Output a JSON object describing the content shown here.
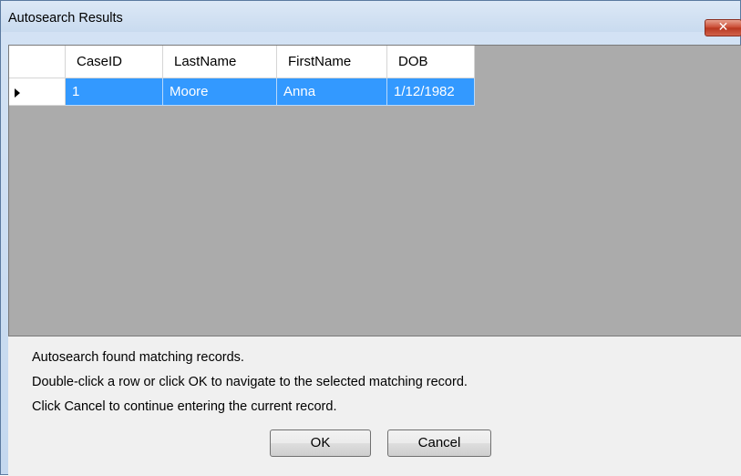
{
  "window": {
    "title": "Autosearch Results",
    "close_glyph": "✕"
  },
  "grid": {
    "columns": [
      "CaseID",
      "LastName",
      "FirstName",
      "DOB"
    ],
    "rows": [
      {
        "CaseID": "1",
        "LastName": "Moore",
        "FirstName": "Anna",
        "DOB": "1/12/1982",
        "selected": true
      }
    ]
  },
  "messages": {
    "line1": "Autosearch found matching records.",
    "line2": "Double-click a row or click OK to navigate to the selected matching record.",
    "line3": "Click Cancel to continue entering the current record."
  },
  "buttons": {
    "ok": "OK",
    "cancel": "Cancel"
  },
  "colors": {
    "selection": "#3399ff",
    "grid_background": "#ababab"
  }
}
